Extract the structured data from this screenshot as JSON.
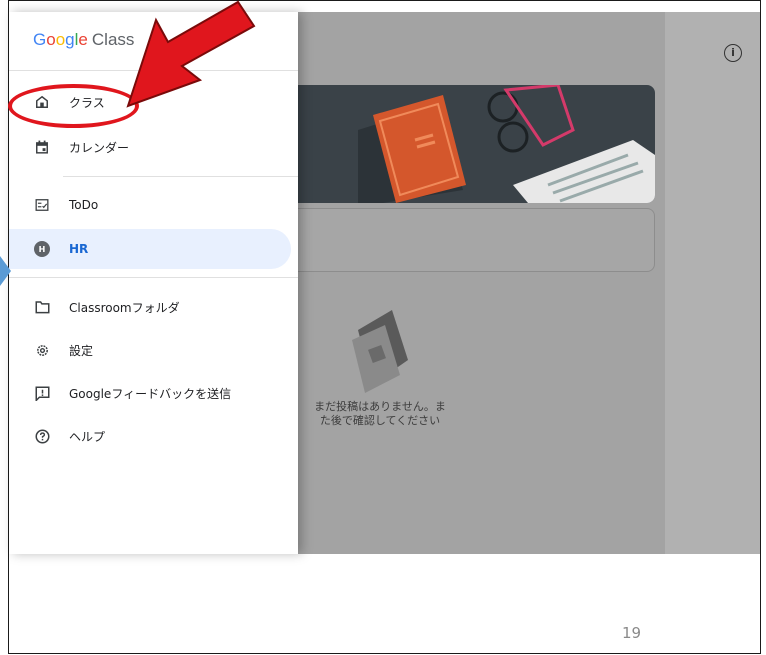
{
  "app": {
    "logo": {
      "g1": "G",
      "g2": "o",
      "g3": "o",
      "g4": "g",
      "g5": "l",
      "g6": "e",
      "product": "Class"
    }
  },
  "nav": {
    "items": [
      {
        "label": "クラス",
        "icon": "home-icon"
      },
      {
        "label": "カレンダー",
        "icon": "calendar-icon"
      },
      {
        "label": "ToDo",
        "icon": "todo-icon"
      },
      {
        "label": "HR",
        "icon": "avatar-icon",
        "avatar_letter": "H",
        "active": true
      },
      {
        "label": "Classroomフォルダ",
        "icon": "folder-icon"
      },
      {
        "label": "設定",
        "icon": "gear-icon"
      },
      {
        "label": "Googleフィードバックを送信",
        "icon": "feedback-icon"
      },
      {
        "label": "ヘルプ",
        "icon": "help-icon"
      }
    ]
  },
  "stream": {
    "info_icon": "i",
    "empty_message": "まだ投稿はありません。また後で確認してください"
  },
  "slide": {
    "page_number": "19"
  },
  "colors": {
    "annotation_red": "#e0161d",
    "active_blue": "#1967d2",
    "active_bg": "#e8f0fe",
    "banner": "#3a4248"
  }
}
